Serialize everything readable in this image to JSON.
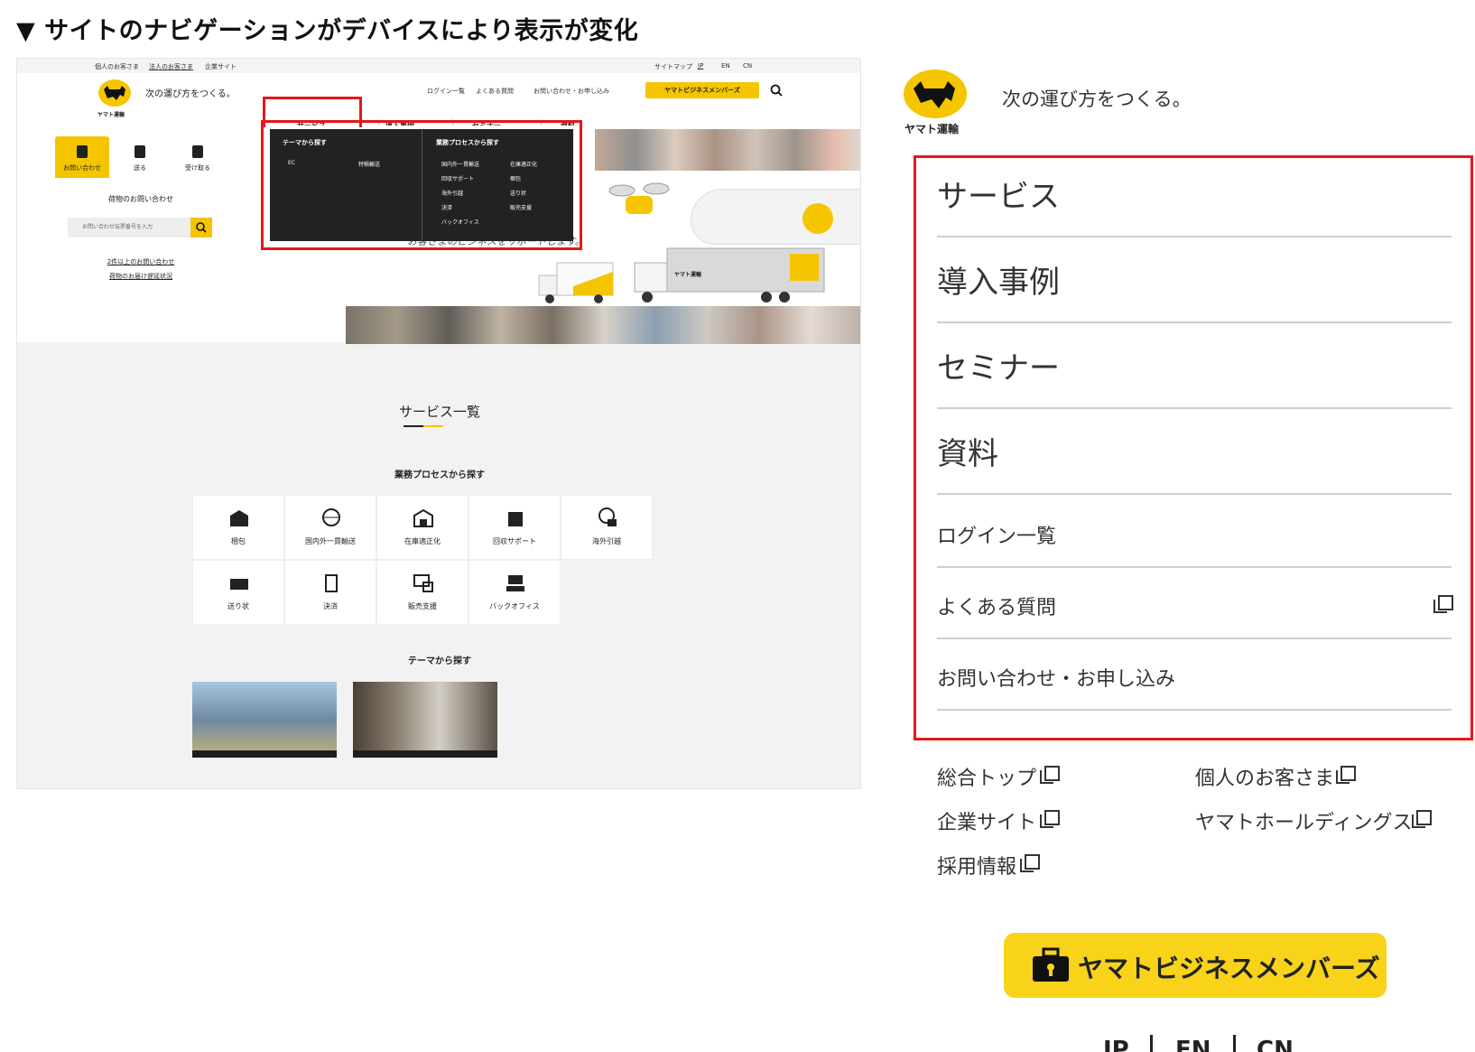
{
  "heading": "▼ サイトのナビゲーションがデバイスにより表示が変化",
  "desktop": {
    "utility_links": [
      "個人のお客さま",
      "法人のお客さま",
      "企業サイト"
    ],
    "utility_right": [
      "サイトマップ",
      "JP",
      "EN",
      "CN"
    ],
    "logo_text": "ヤマト運輸",
    "tagline": "次の運び方をつくる。",
    "top_links": [
      "ログイン一覧",
      "よくある質問",
      "お問い合わせ・お申し込み"
    ],
    "member_button": "ヤマトビジネスメンバーズ",
    "nav": [
      "サービス ⌄",
      "導入事例",
      "セミナー",
      "資料"
    ],
    "dropdown": {
      "left_heading": "テーマから探す",
      "left_items": [
        "EC",
        "特積輸送"
      ],
      "right_heading": "業務プロセスから探す",
      "right_items": [
        "国内外一貫輸送",
        "在庫適正化",
        "回収サポート",
        "梱包",
        "海外引越",
        "送り状",
        "決済",
        "販売支援",
        "バックオフィス"
      ]
    },
    "hero_text": "お客さまのビジネスをサポートします。",
    "truck_label": "ヤマト運輸",
    "sidebar": {
      "tabs": [
        "お問い合わせ",
        "送る",
        "受け取る"
      ],
      "title": "荷物のお問い合わせ",
      "placeholder": "お問い合わせ伝票番号を入力",
      "links": [
        "2件以上のお問い合わせ",
        "荷物のお届け遅延状況"
      ]
    },
    "services_title": "サービス一覧",
    "process_heading": "業務プロセスから探す",
    "process_items": [
      "梱包",
      "国内外一貫輸送",
      "在庫適正化",
      "回収サポート",
      "海外引越",
      "送り状",
      "決済",
      "販売支援",
      "バックオフィス"
    ],
    "theme_heading": "テーマから探す"
  },
  "mobile": {
    "logo_text": "ヤマト運輸",
    "tagline": "次の運び方をつくる。",
    "menu": [
      "サービス",
      "導入事例",
      "セミナー",
      "資料"
    ],
    "links": [
      "ログイン一覧",
      "よくある質問",
      "お問い合わせ・お申し込み"
    ],
    "footer_links": [
      "総合トップ",
      "個人のお客さま",
      "企業サイト",
      "ヤマトホールディングス",
      "採用情報"
    ],
    "member_button": "ヤマトビジネスメンバーズ",
    "languages": [
      "JP",
      "EN",
      "CN"
    ]
  },
  "colors": {
    "accent": "#f5c500",
    "highlight": "#e8161a",
    "dark": "#222222"
  }
}
